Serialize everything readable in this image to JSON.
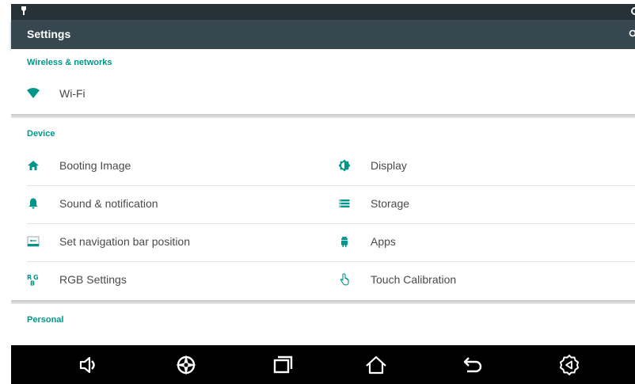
{
  "app_bar": {
    "title": "Settings"
  },
  "colors": {
    "accent": "#009688",
    "app_bar": "#37474f",
    "status_bar": "#263238"
  },
  "sections": {
    "wireless": {
      "header": "Wireless & networks",
      "items": [
        {
          "label": "Wi-Fi",
          "icon": "wifi-icon"
        }
      ]
    },
    "device": {
      "header": "Device",
      "left": [
        {
          "label": "Booting Image",
          "icon": "home-icon"
        },
        {
          "label": "Sound & notification",
          "icon": "bell-icon"
        },
        {
          "label": "Set navigation bar position",
          "icon": "nav-position-icon"
        },
        {
          "label": "RGB Settings",
          "icon": "rgb-icon"
        }
      ],
      "right": [
        {
          "label": "Display",
          "icon": "brightness-icon"
        },
        {
          "label": "Storage",
          "icon": "storage-icon"
        },
        {
          "label": "Apps",
          "icon": "android-icon"
        },
        {
          "label": "Touch Calibration",
          "icon": "touch-icon"
        }
      ]
    },
    "personal": {
      "header": "Personal"
    }
  },
  "nav_bar": {
    "buttons": [
      "volume-icon",
      "compass-icon",
      "recents-icon",
      "home-icon",
      "back-icon",
      "settings-shortcut-icon"
    ]
  }
}
